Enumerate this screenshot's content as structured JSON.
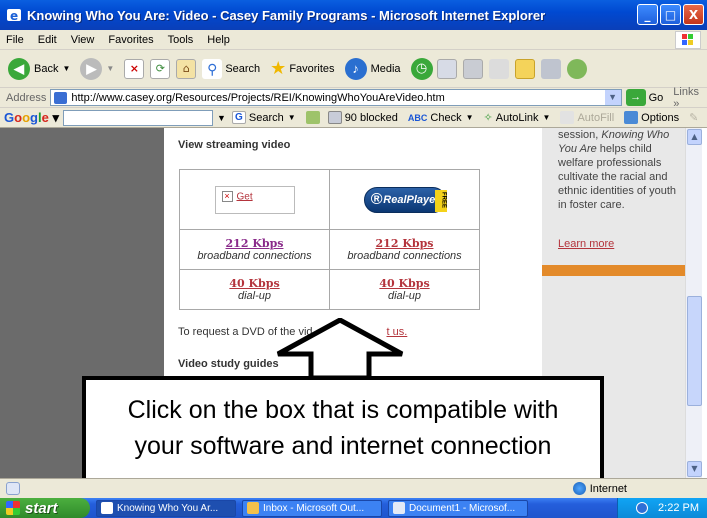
{
  "window": {
    "title": "Knowing Who You Are: Video - Casey Family Programs - Microsoft Internet Explorer",
    "buttons": {
      "minimize": "_",
      "maximize": "□",
      "close": "X"
    }
  },
  "menu": [
    "File",
    "Edit",
    "View",
    "Favorites",
    "Tools",
    "Help"
  ],
  "toolbar": {
    "back": "Back",
    "search": "Search",
    "favorites": "Favorites",
    "media": "Media"
  },
  "address": {
    "label": "Address",
    "url": "http://www.casey.org/Resources/Projects/REI/KnowingWhoYouAreVideo.htm",
    "go": "Go",
    "links": "Links"
  },
  "google_bar": {
    "logo": {
      "G": "G",
      "o1": "o",
      "o2": "o",
      "g": "g",
      "l": "l",
      "e": "e"
    },
    "search": "Search",
    "blocked": "90 blocked",
    "check": "Check",
    "autolink": "AutoLink",
    "autofill": "AutoFill",
    "options": "Options"
  },
  "main": {
    "heading": "View streaming video",
    "get_label": "Get",
    "realplayer_label": "RealPlayer",
    "realplayer_free": "FREE",
    "rows": [
      {
        "left_speed": "212 Kbps",
        "left_conn": "broadband connections",
        "right_speed": "212 Kbps",
        "right_conn": "broadband connections"
      },
      {
        "left_speed": "40 Kbps",
        "left_conn": "dial-up",
        "right_speed": "40 Kbps",
        "right_conn": "dial-up"
      }
    ],
    "dvd_text_start": "To request a DVD of the vid",
    "dvd_link": "t us.",
    "study_guides": "Video study guides"
  },
  "right_col": {
    "text_1": "session, ",
    "text_italic": "Knowing Who You Are",
    "text_2": " helps child welfare professionals cultivate the racial and ethnic identities of youth in foster care.",
    "learn_more": "Learn more"
  },
  "callout": {
    "line1": "Click on the box that is compatible with",
    "line2": "your software and internet connection"
  },
  "status": {
    "zone": "Internet"
  },
  "taskbar": {
    "start": "start",
    "tasks": [
      "Knowing Who You Ar...",
      "Inbox - Microsoft Out...",
      "Document1 - Microsof..."
    ],
    "clock": "2:22 PM"
  }
}
